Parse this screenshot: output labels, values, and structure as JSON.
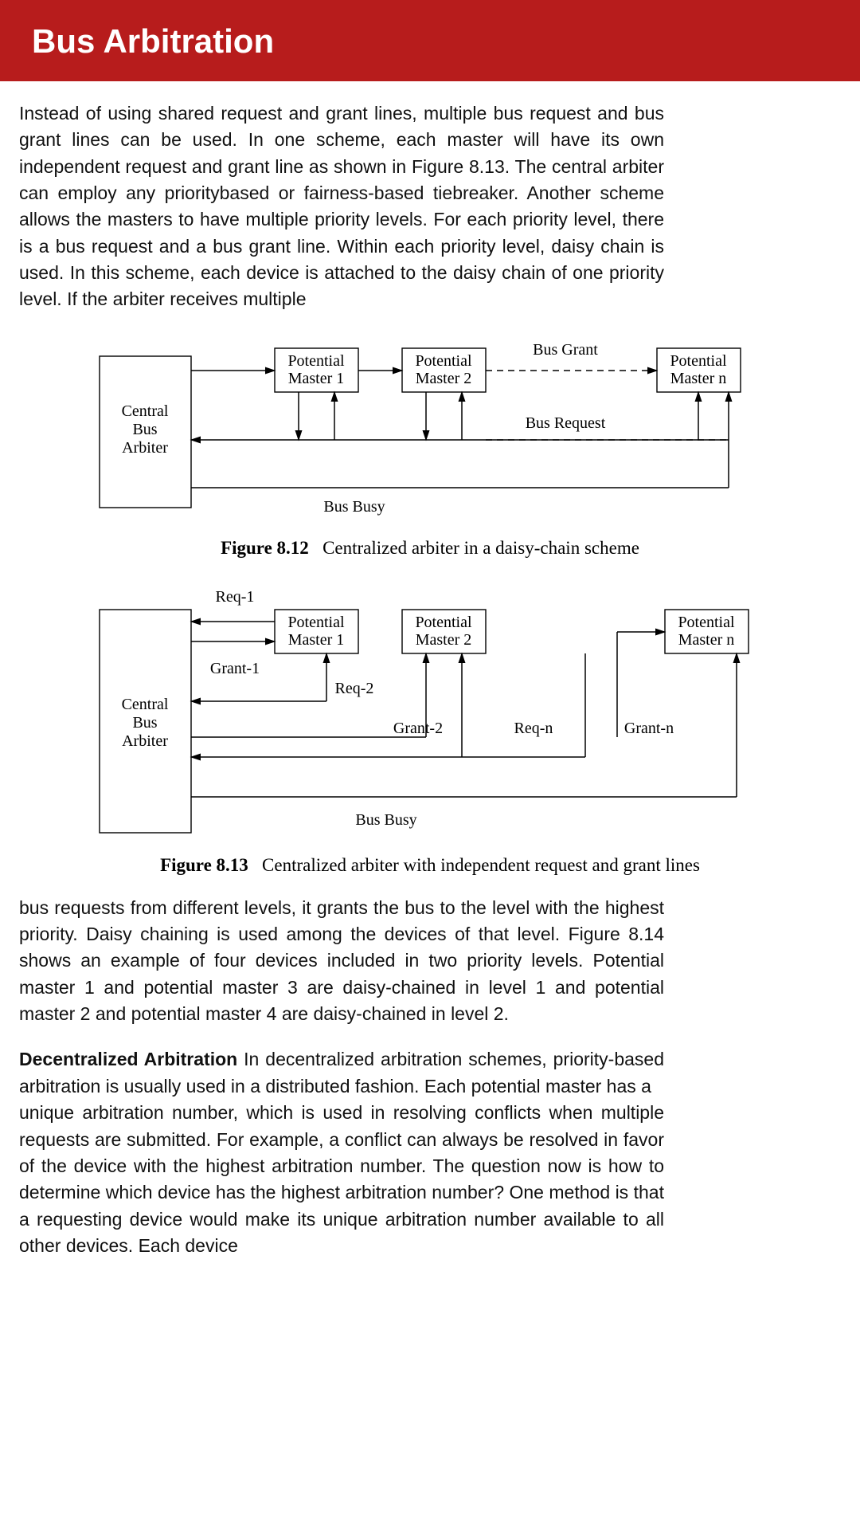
{
  "header": {
    "title": "Bus Arbitration"
  },
  "para1": "Instead of using shared request and grant lines, multiple bus request and bus grant lines can be used. In one scheme, each master will have its own independent request and grant line as shown in Figure 8.13. The central arbiter can employ any prioritybased or fairness-based tiebreaker. Another scheme allows the masters to have multiple priority levels. For each priority level, there is a bus request and a bus grant line. Within each priority level, daisy chain is used. In this scheme, each device is attached to the daisy chain of one priority level. If the arbiter receives multiple",
  "fig12": {
    "arbiter_l1": "Central",
    "arbiter_l2": "Bus",
    "arbiter_l3": "Arbiter",
    "m1_l1": "Potential",
    "m1_l2": "Master 1",
    "m2_l1": "Potential",
    "m2_l2": "Master 2",
    "mn_l1": "Potential",
    "mn_l2": "Master n",
    "busgrant": "Bus Grant",
    "busrequest": "Bus Request",
    "busbusy": "Bus Busy",
    "cap_b": "Figure 8.12",
    "cap_t": "Centralized arbiter in a daisy-chain scheme"
  },
  "fig13": {
    "arbiter_l1": "Central",
    "arbiter_l2": "Bus",
    "arbiter_l3": "Arbiter",
    "m1_l1": "Potential",
    "m1_l2": "Master 1",
    "m2_l1": "Potential",
    "m2_l2": "Master 2",
    "mn_l1": "Potential",
    "mn_l2": "Master n",
    "req1": "Req-1",
    "grant1": "Grant-1",
    "req2": "Req-2",
    "grant2": "Grant-2",
    "reqn": "Req-n",
    "grantn": "Grant-n",
    "busbusy": "Bus Busy",
    "cap_b": "Figure 8.13",
    "cap_t": "Centralized arbiter with independent request and grant lines"
  },
  "para2": "bus requests from different levels, it grants the bus to the level with the highest priority. Daisy chaining is used among the devices of that level. Figure 8.14 shows an example of four devices included in two priority levels. Potential master 1 and potential master 3 are daisy-chained in level 1 and potential master 2 and potential master 4 are daisy-chained in level 2.",
  "para3_bold": "Decentralized Arbitration",
  "para3a": " In decentralized arbitration schemes, priority-based arbitration is usually used in a distributed fashion. Each potential master has a",
  "para3b": "unique arbitration number, which is used in resolving conflicts when multiple requests are submitted. For example, a conflict can always be resolved in favor of the device with the highest arbitration number. The question now is how to determine which device has the highest arbitration number? One method is that a requesting device would make its unique arbitration number available to all other devices. Each device"
}
